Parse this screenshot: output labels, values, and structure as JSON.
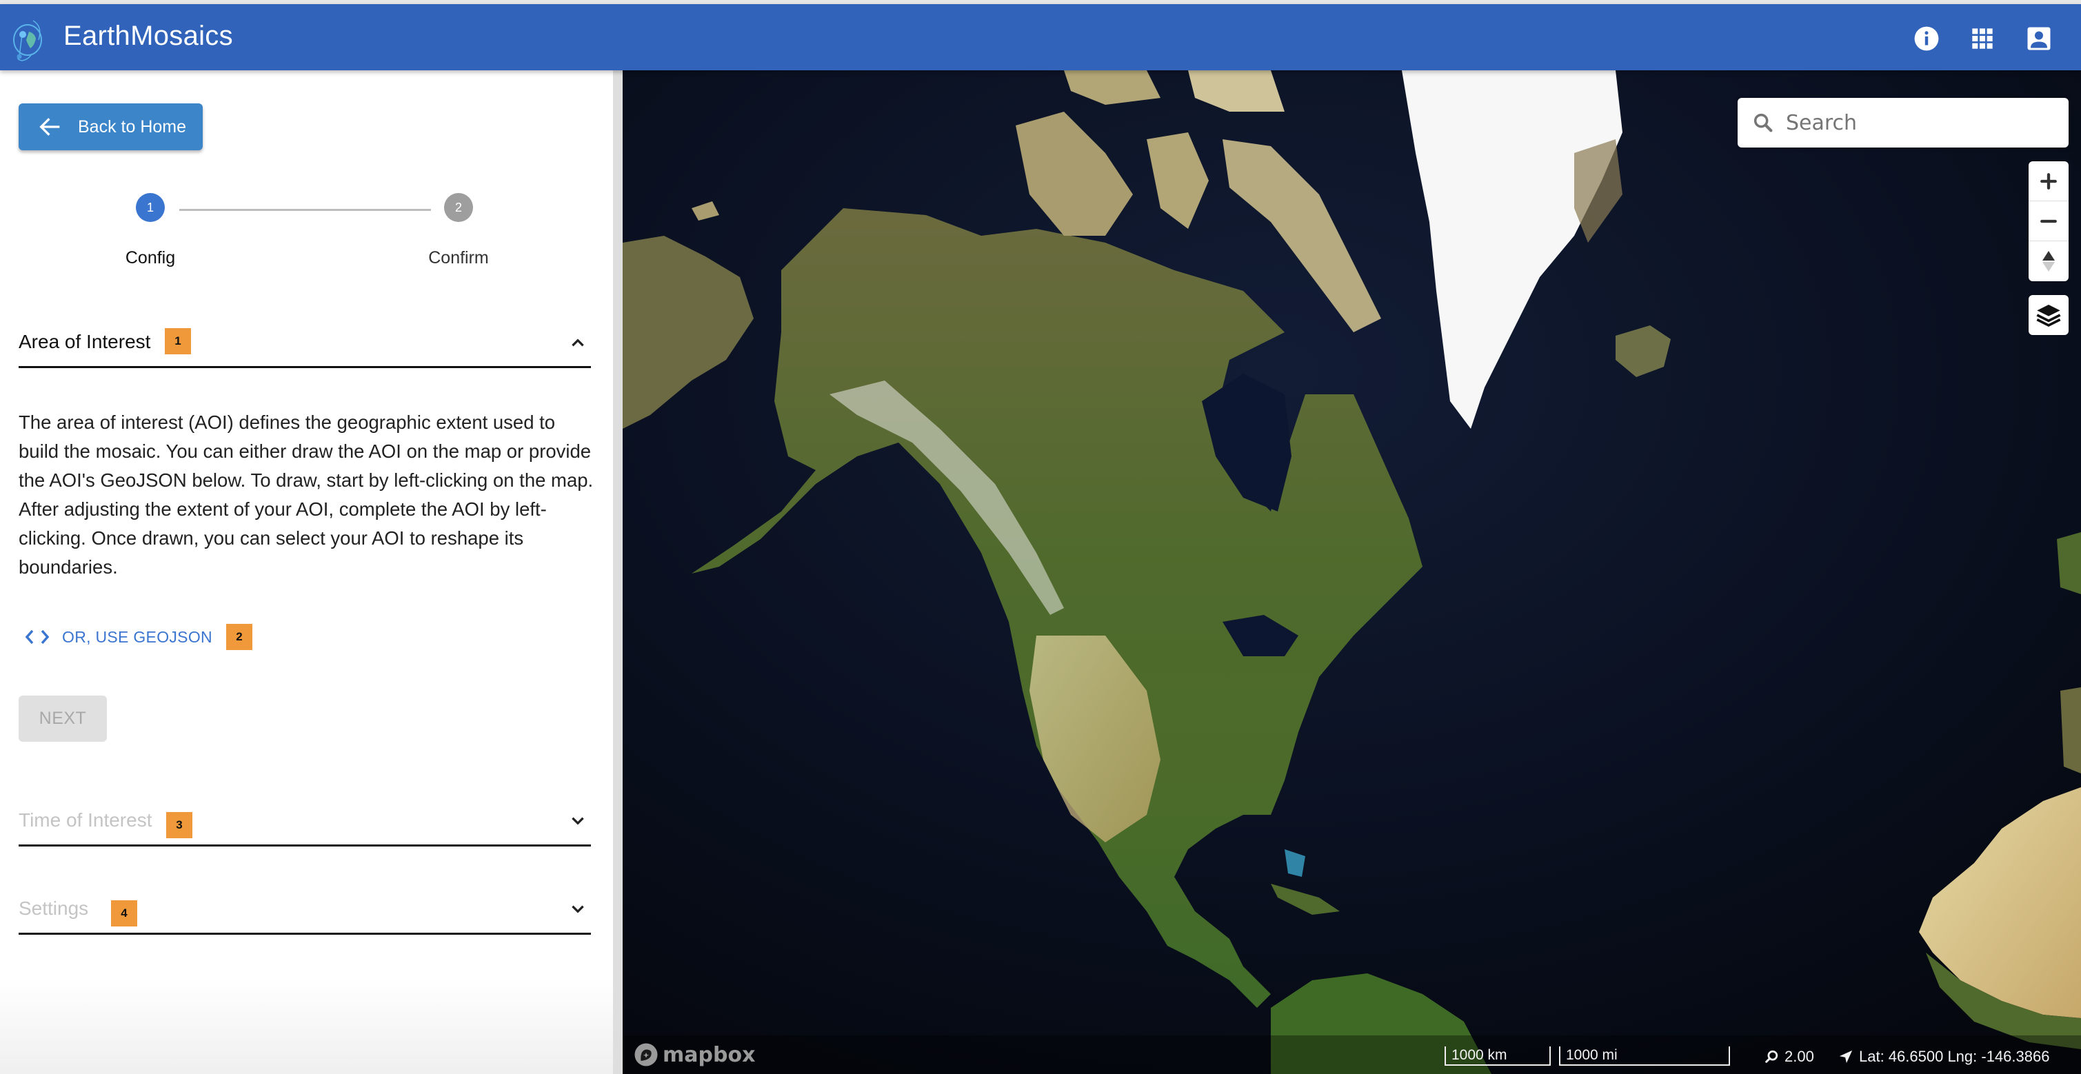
{
  "header": {
    "app_title": "EarthMosaics",
    "icons": [
      "info-icon",
      "apps-grid-icon",
      "account-box-icon"
    ],
    "brand_color": "#3063b9"
  },
  "sidebar": {
    "back_button": {
      "label": "Back to Home",
      "icon": "arrow-left-icon"
    },
    "stepper": {
      "steps": [
        {
          "number": "1",
          "label": "Config",
          "state": "active"
        },
        {
          "number": "2",
          "label": "Confirm",
          "state": "inactive"
        }
      ]
    },
    "sections": {
      "aoi": {
        "title": "Area of Interest",
        "badge": "1",
        "expanded": true,
        "description": "The area of interest (AOI) defines the geographic extent used to build the mosaic. You can either draw the AOI on the map or provide the AOI's GeoJSON below. To draw, start by left-clicking on the map. After adjusting the extent of your AOI, complete the AOI by left-clicking. Once drawn, you can select your AOI to reshape its boundaries.",
        "geojson_link": {
          "label": "OR, USE GEOJSON",
          "badge": "2",
          "icon": "code-icon"
        },
        "next_button": {
          "label": "NEXT",
          "disabled": true
        }
      },
      "toi": {
        "title": "Time of Interest",
        "badge": "3",
        "expanded": false,
        "disabled": true
      },
      "settings": {
        "title": "Settings",
        "badge": "4",
        "expanded": false,
        "disabled": true
      }
    },
    "badge_color": "#f0993a"
  },
  "map": {
    "search": {
      "placeholder": "Search",
      "value": ""
    },
    "controls": {
      "zoom_in": "zoom-in",
      "zoom_out": "zoom-out",
      "compass": "reset-north",
      "layers": "layers"
    },
    "attribution": "mapbox",
    "scale_metric": "1000 km",
    "scale_imperial": "1000 mi",
    "zoom_level": "2.00",
    "coordinates": "Lat: 46.6500 Lng: -146.3866"
  }
}
